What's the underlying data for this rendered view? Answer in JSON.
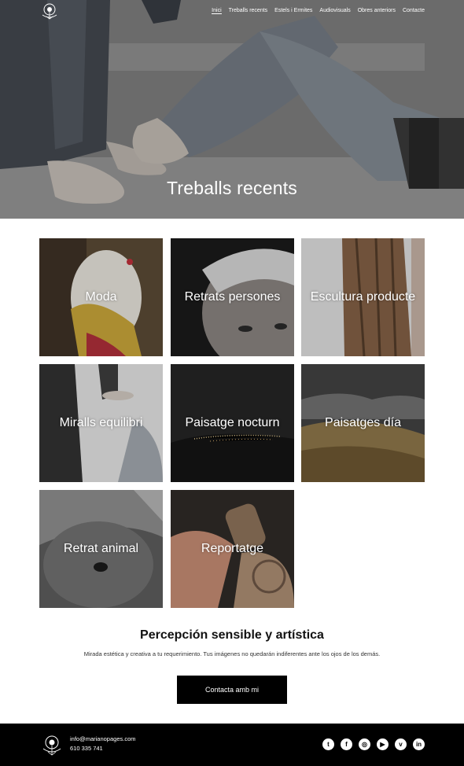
{
  "nav": {
    "items": [
      {
        "label": "Inici",
        "active": true
      },
      {
        "label": "Treballs recents"
      },
      {
        "label": "Estels i Ermites"
      },
      {
        "label": "Audiovisuals"
      },
      {
        "label": "Obres anteriors"
      },
      {
        "label": "Contacte"
      }
    ]
  },
  "hero": {
    "title": "Treballs recents"
  },
  "gallery": {
    "tiles": [
      {
        "label": "Moda"
      },
      {
        "label": "Retrats persones"
      },
      {
        "label": "Escultura producte"
      },
      {
        "label": "Miralls equilibri"
      },
      {
        "label": "Paisatge nocturn"
      },
      {
        "label": "Paisatges día"
      },
      {
        "label": "Retrat animal"
      },
      {
        "label": "Reportatge"
      }
    ]
  },
  "cta": {
    "title": "Percepción sensible y artística",
    "text": "Mirada estética y creativa a tu requerimiento. Tus imágenes no quedarán indiferentes ante los ojos de los demás.",
    "button": "Contacta amb mi"
  },
  "footer": {
    "email": "info@marianopages.com",
    "phone": "610 335 741",
    "socials": [
      {
        "icon": "twitter-icon",
        "glyph": "t"
      },
      {
        "icon": "facebook-icon",
        "glyph": "f"
      },
      {
        "icon": "instagram-icon",
        "glyph": "◎"
      },
      {
        "icon": "youtube-icon",
        "glyph": "▶"
      },
      {
        "icon": "vimeo-icon",
        "glyph": "v"
      },
      {
        "icon": "linkedin-icon",
        "glyph": "in"
      }
    ]
  }
}
